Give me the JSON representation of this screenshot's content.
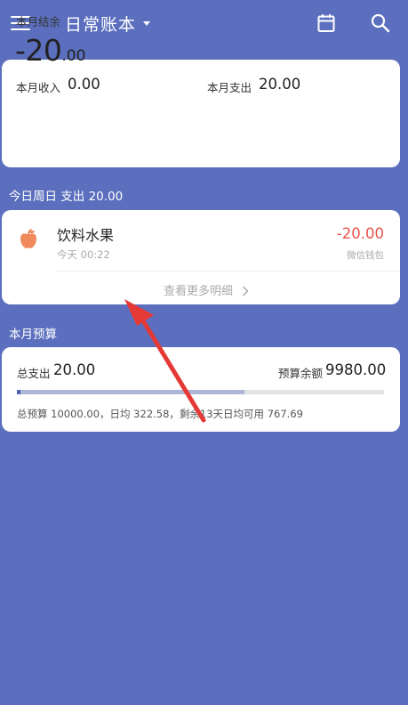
{
  "header": {
    "book_title": "日常账本",
    "menu_icon": "menu-icon",
    "dropdown_icon": "caret-down-icon",
    "calendar_icon": "calendar-icon",
    "search_icon": "search-icon"
  },
  "summary": {
    "label": "本月结余",
    "balance_main": "-20",
    "balance_decimal": ".00",
    "income_label": "本月收入",
    "income_value": "0.00",
    "expense_label": "本月支出",
    "expense_value": "20.00"
  },
  "today": {
    "header": "今日周日  支出 20.00",
    "entries": [
      {
        "icon": "apple-icon",
        "name": "饮料水果",
        "time": "今天 00:22",
        "amount": "-20.00",
        "account": "微信钱包"
      }
    ],
    "more_label": "查看更多明细"
  },
  "budget": {
    "header": "本月预算",
    "total_label": "总支出",
    "total_value": "20.00",
    "remain_label": "预算余额",
    "remain_value": "9980.00",
    "progress_fraction": 0.62,
    "detail": "总预算 10000.00，日均 322.58，剩余13天日均可用 767.69"
  },
  "colors": {
    "background": "#5b6fbe",
    "card": "#ffffff",
    "expense_red": "#e8534d",
    "annotation_arrow": "#e53935",
    "progress_fill": "#aeb6d8"
  }
}
